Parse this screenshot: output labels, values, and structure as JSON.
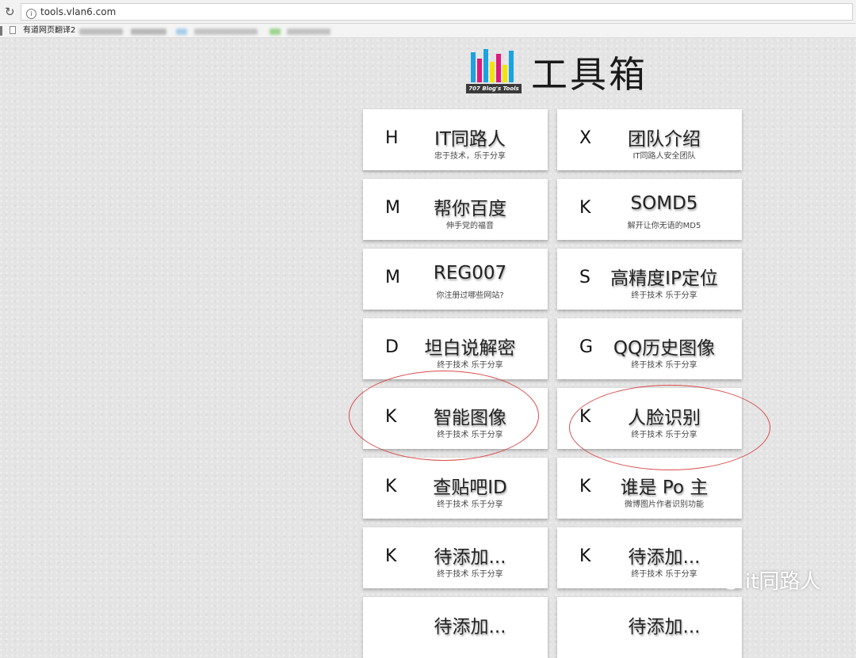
{
  "browser": {
    "url": "tools.vlan6.com",
    "bookmark_label": "有道网页翻译2"
  },
  "header": {
    "logo_text": "707 Blog's Tools",
    "title": "工具箱"
  },
  "tools": [
    {
      "letter": "H",
      "title": "IT同路人",
      "subtitle": "忠于技术，乐于分享"
    },
    {
      "letter": "X",
      "title": "团队介绍",
      "subtitle": "IT同路人安全团队"
    },
    {
      "letter": "M",
      "title": "帮你百度",
      "subtitle": "伸手党的福音"
    },
    {
      "letter": "K",
      "title": "SOMD5",
      "subtitle": "解开让你无语的MD5"
    },
    {
      "letter": "M",
      "title": "REG007",
      "subtitle": "你注册过哪些网站?"
    },
    {
      "letter": "S",
      "title": "高精度IP定位",
      "subtitle": "终于技术 乐于分享"
    },
    {
      "letter": "D",
      "title": "坦白说解密",
      "subtitle": "终于技术 乐于分享"
    },
    {
      "letter": "G",
      "title": "QQ历史图像",
      "subtitle": "终于技术 乐于分享"
    },
    {
      "letter": "K",
      "title": "智能图像",
      "subtitle": "终于技术 乐于分享"
    },
    {
      "letter": "K",
      "title": "人脸识别",
      "subtitle": "终于技术 乐于分享"
    },
    {
      "letter": "K",
      "title": "查贴吧ID",
      "subtitle": "终于技术 乐于分享"
    },
    {
      "letter": "K",
      "title": "谁是 Po 主",
      "subtitle": "微博图片作者识别功能"
    },
    {
      "letter": "K",
      "title": "待添加...",
      "subtitle": "终于技术 乐于分享"
    },
    {
      "letter": "K",
      "title": "待添加...",
      "subtitle": "终于技术 乐于分享"
    },
    {
      "letter": "",
      "title": "待添加...",
      "subtitle": ""
    },
    {
      "letter": "",
      "title": "待添加...",
      "subtitle": ""
    }
  ],
  "watermark": {
    "text": "it同路人"
  },
  "colors": {
    "annotation": "#d94a4a",
    "card_bg": "#ffffff",
    "page_bg": "#e4e4e4"
  }
}
